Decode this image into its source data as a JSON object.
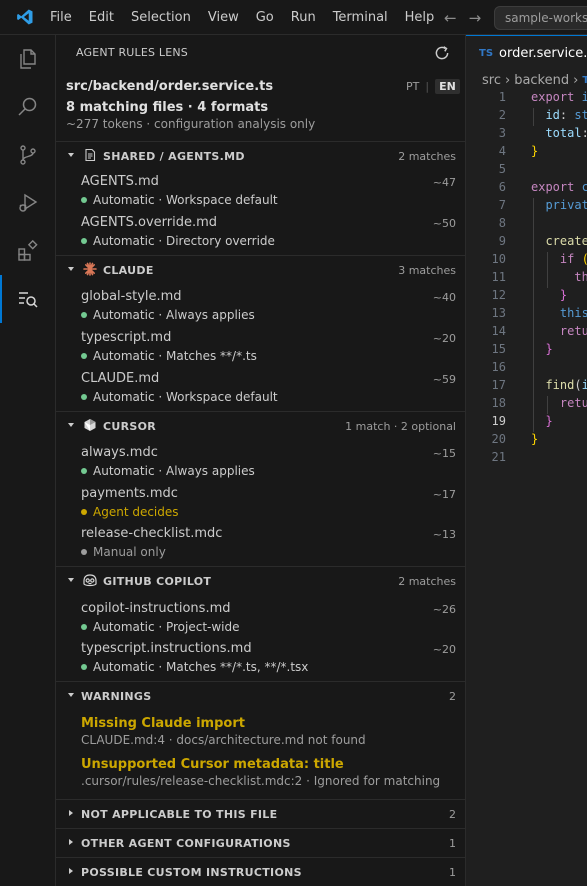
{
  "menu": [
    "File",
    "Edit",
    "Selection",
    "View",
    "Go",
    "Run",
    "Terminal",
    "Help"
  ],
  "command_center": "sample-workspace",
  "panel": {
    "title": "AGENT RULES LENS",
    "file_path": "src/backend/order.service.ts",
    "lang_pt": "PT",
    "lang_en": "EN",
    "summary": "8 matching files · 4 formats",
    "subsummary": "~277 tokens · configuration analysis only"
  },
  "sections": [
    {
      "label": "SHARED / AGENTS.MD",
      "count": "2 matches",
      "items": [
        {
          "name": "AGENTS.md",
          "meta": "Automatic · Workspace default",
          "tokens": "~47",
          "status": "green"
        },
        {
          "name": "AGENTS.override.md",
          "meta": "Automatic · Directory override",
          "tokens": "~50",
          "status": "green"
        }
      ]
    },
    {
      "label": "CLAUDE",
      "count": "3 matches",
      "items": [
        {
          "name": "global-style.md",
          "meta": "Automatic · Always applies",
          "tokens": "~40",
          "status": "green"
        },
        {
          "name": "typescript.md",
          "meta": "Automatic · Matches **/*.ts",
          "tokens": "~20",
          "status": "green"
        },
        {
          "name": "CLAUDE.md",
          "meta": "Automatic · Workspace default",
          "tokens": "~59",
          "status": "green"
        }
      ]
    },
    {
      "label": "CURSOR",
      "count": "1 match · 2 optional",
      "items": [
        {
          "name": "always.mdc",
          "meta": "Automatic · Always applies",
          "tokens": "~15",
          "status": "green"
        },
        {
          "name": "payments.mdc",
          "meta": "Agent decides",
          "tokens": "~17",
          "status": "amber"
        },
        {
          "name": "release-checklist.mdc",
          "meta": "Manual only",
          "tokens": "~13",
          "status": "gray"
        }
      ]
    },
    {
      "label": "GITHUB COPILOT",
      "count": "2 matches",
      "items": [
        {
          "name": "copilot-instructions.md",
          "meta": "Automatic · Project-wide",
          "tokens": "~26",
          "status": "green"
        },
        {
          "name": "typescript.instructions.md",
          "meta": "Automatic · Matches **/*.ts, **/*.tsx",
          "tokens": "~20",
          "status": "green"
        }
      ]
    }
  ],
  "warnings": {
    "label": "WARNINGS",
    "count": "2",
    "items": [
      {
        "title": "Missing Claude import",
        "detail": "CLAUDE.md:4 · docs/architecture.md not found"
      },
      {
        "title": "Unsupported Cursor metadata: title",
        "detail": ".cursor/rules/release-checklist.mdc:2 · Ignored for matching"
      }
    ]
  },
  "collapsed": [
    {
      "label": "NOT APPLICABLE TO THIS FILE",
      "count": "2"
    },
    {
      "label": "OTHER AGENT CONFIGURATIONS",
      "count": "1"
    },
    {
      "label": "POSSIBLE CUSTOM INSTRUCTIONS",
      "count": "1"
    }
  ],
  "editor": {
    "tab_badge": "TS",
    "tab_name": "order.service.ts",
    "crumb_1": "src",
    "crumb_2": "backend",
    "crumb_3": "T",
    "current_line": "19",
    "line_numbers": [
      "1",
      "2",
      "3",
      "4",
      "5",
      "6",
      "7",
      "8",
      "9",
      "10",
      "11",
      "12",
      "13",
      "14",
      "15",
      "16",
      "17",
      "18",
      "19",
      "20",
      "21"
    ]
  },
  "colors": {
    "accent": "#0078d4",
    "status_green": "#73c991",
    "status_amber": "#cca700",
    "status_gray": "#9d9d9d",
    "claude_orange": "#d97757"
  }
}
